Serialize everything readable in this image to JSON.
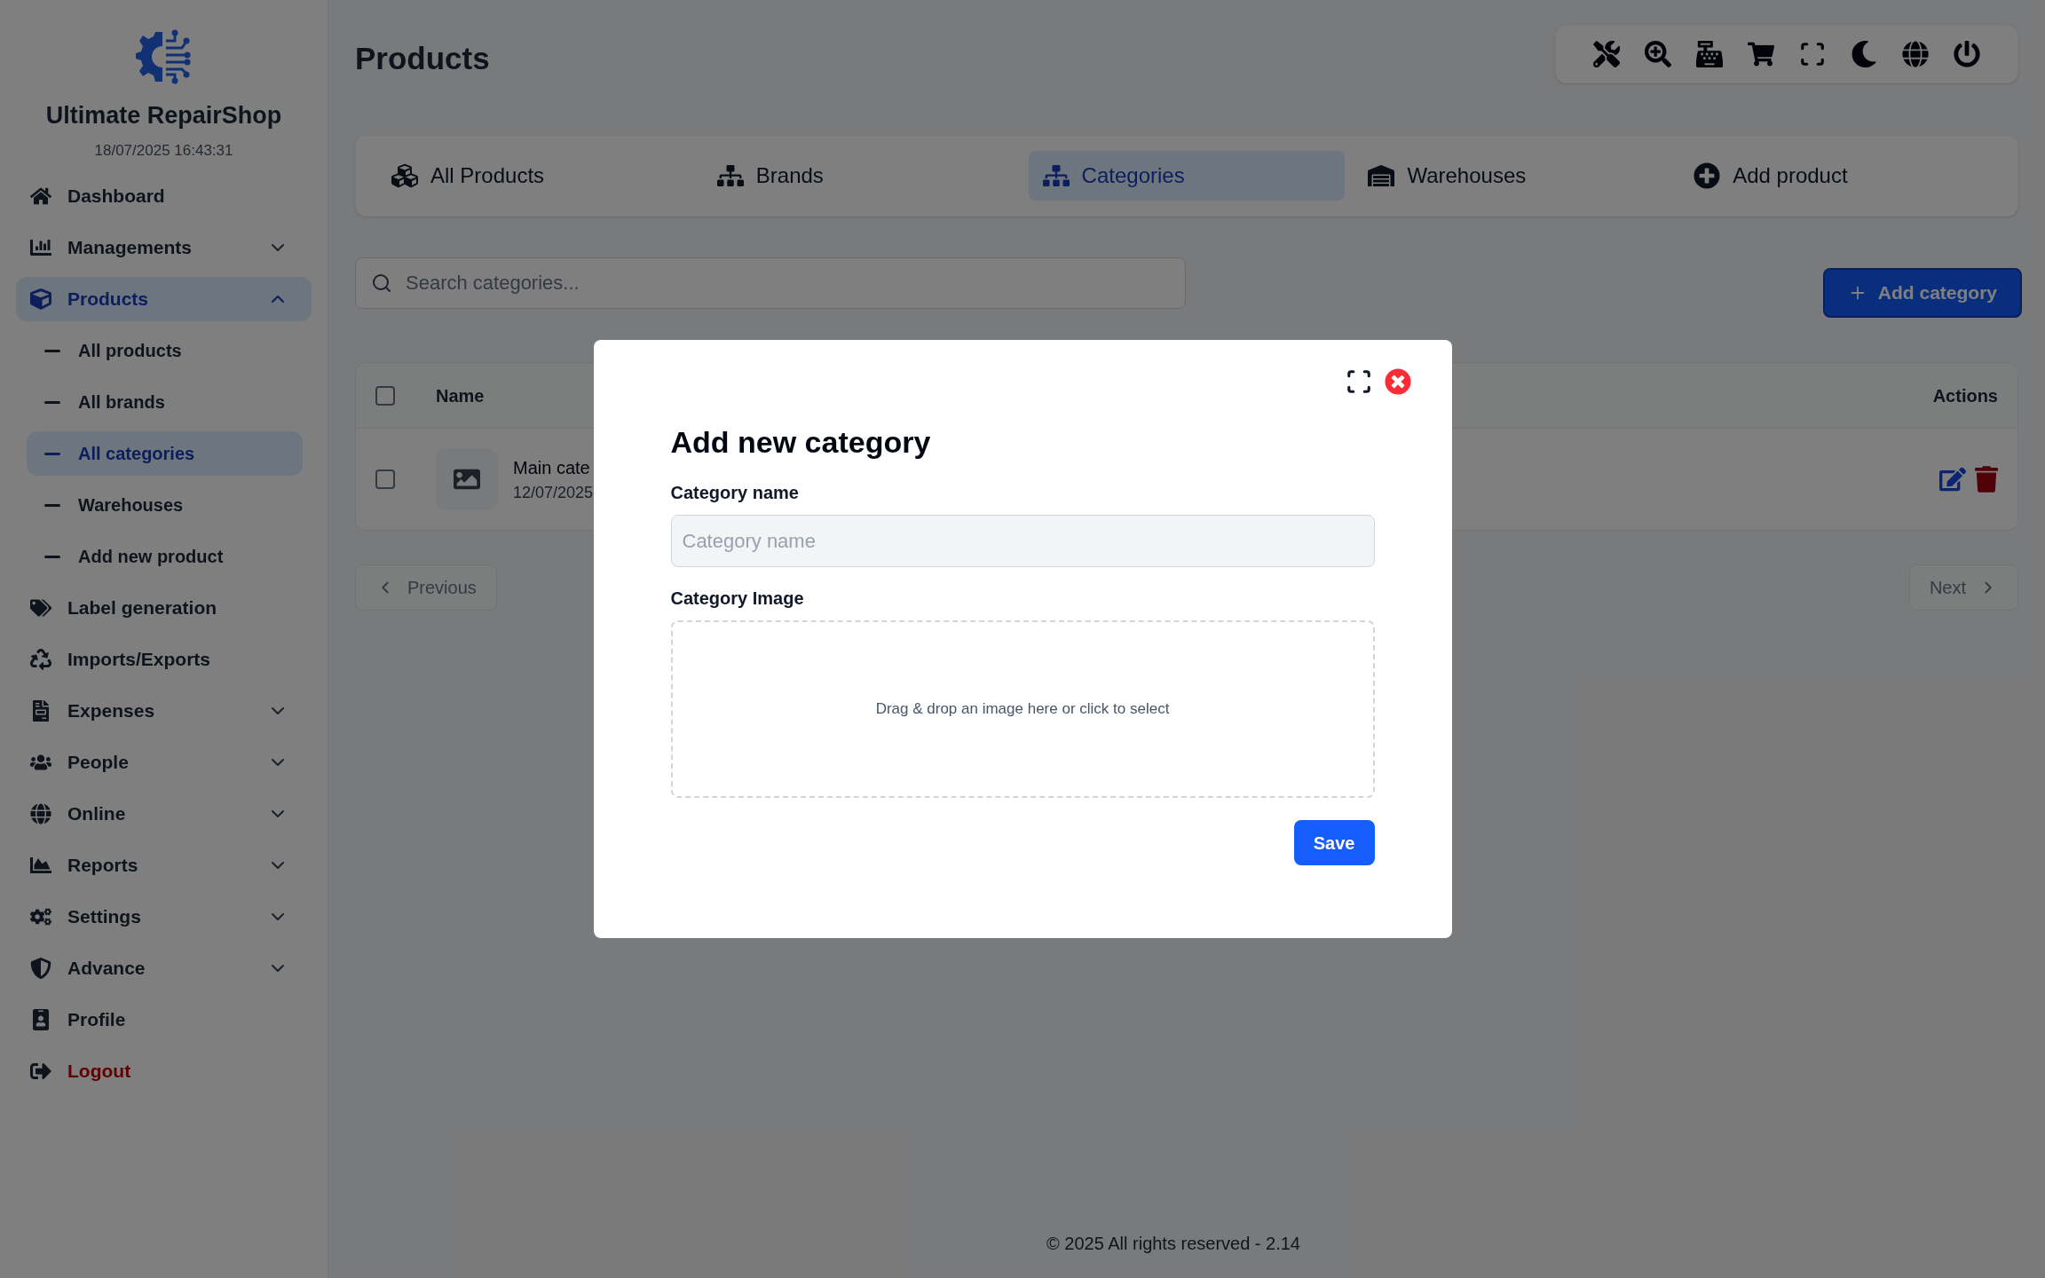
{
  "app": {
    "name": "Ultimate RepairShop",
    "datetime": "18/07/2025 16:43:31"
  },
  "sidebar": {
    "items": [
      {
        "label": "Dashboard",
        "kind": "normal",
        "selected": false
      },
      {
        "label": "Managements",
        "kind": "normal",
        "selected": false,
        "expanded": false
      },
      {
        "label": "Products",
        "kind": "normal",
        "selected": true,
        "expanded": true,
        "children": [
          {
            "label": "All products",
            "selected": false
          },
          {
            "label": "All brands",
            "selected": false
          },
          {
            "label": "All categories",
            "selected": true
          },
          {
            "label": "Warehouses",
            "selected": false
          },
          {
            "label": "Add new product",
            "selected": false
          }
        ]
      },
      {
        "label": "Label generation",
        "kind": "normal",
        "selected": false
      },
      {
        "label": "Imports/Exports",
        "kind": "normal",
        "selected": false
      },
      {
        "label": "Expenses",
        "kind": "normal",
        "selected": false,
        "expanded": false
      },
      {
        "label": "People",
        "kind": "normal",
        "selected": false,
        "expanded": false
      },
      {
        "label": "Online",
        "kind": "normal",
        "selected": false,
        "expanded": false
      },
      {
        "label": "Reports",
        "kind": "normal",
        "selected": false,
        "expanded": false
      },
      {
        "label": "Settings",
        "kind": "normal",
        "selected": false,
        "expanded": false
      },
      {
        "label": "Advance",
        "kind": "normal",
        "selected": false,
        "expanded": false
      },
      {
        "label": "Profile",
        "kind": "normal",
        "selected": false
      },
      {
        "label": "Logout",
        "kind": "logout",
        "selected": false
      }
    ]
  },
  "header": {
    "title": "Products"
  },
  "tabs": [
    {
      "label": "All Products",
      "selected": false
    },
    {
      "label": "Brands",
      "selected": false
    },
    {
      "label": "Categories",
      "selected": true
    },
    {
      "label": "Warehouses",
      "selected": false
    },
    {
      "label": "Add product",
      "selected": false
    }
  ],
  "search": {
    "placeholder": "Search categories..."
  },
  "add_button": {
    "label": "Add category"
  },
  "table": {
    "columns": [
      "Name",
      "Actions"
    ],
    "select_all": {
      "checked": false
    },
    "rows": [
      {
        "name": "Main cate",
        "date": "12/07/2025",
        "checked": false
      }
    ]
  },
  "pagination": {
    "previous": "Previous",
    "next": "Next"
  },
  "footer": "© 2025 All rights reserved - 2.14",
  "modal": {
    "title": "Add new category",
    "name_label": "Category name",
    "name_placeholder": "Category name",
    "image_label": "Category Image",
    "dropzone": "Drag & drop an image here or click to select",
    "save": "Save"
  }
}
